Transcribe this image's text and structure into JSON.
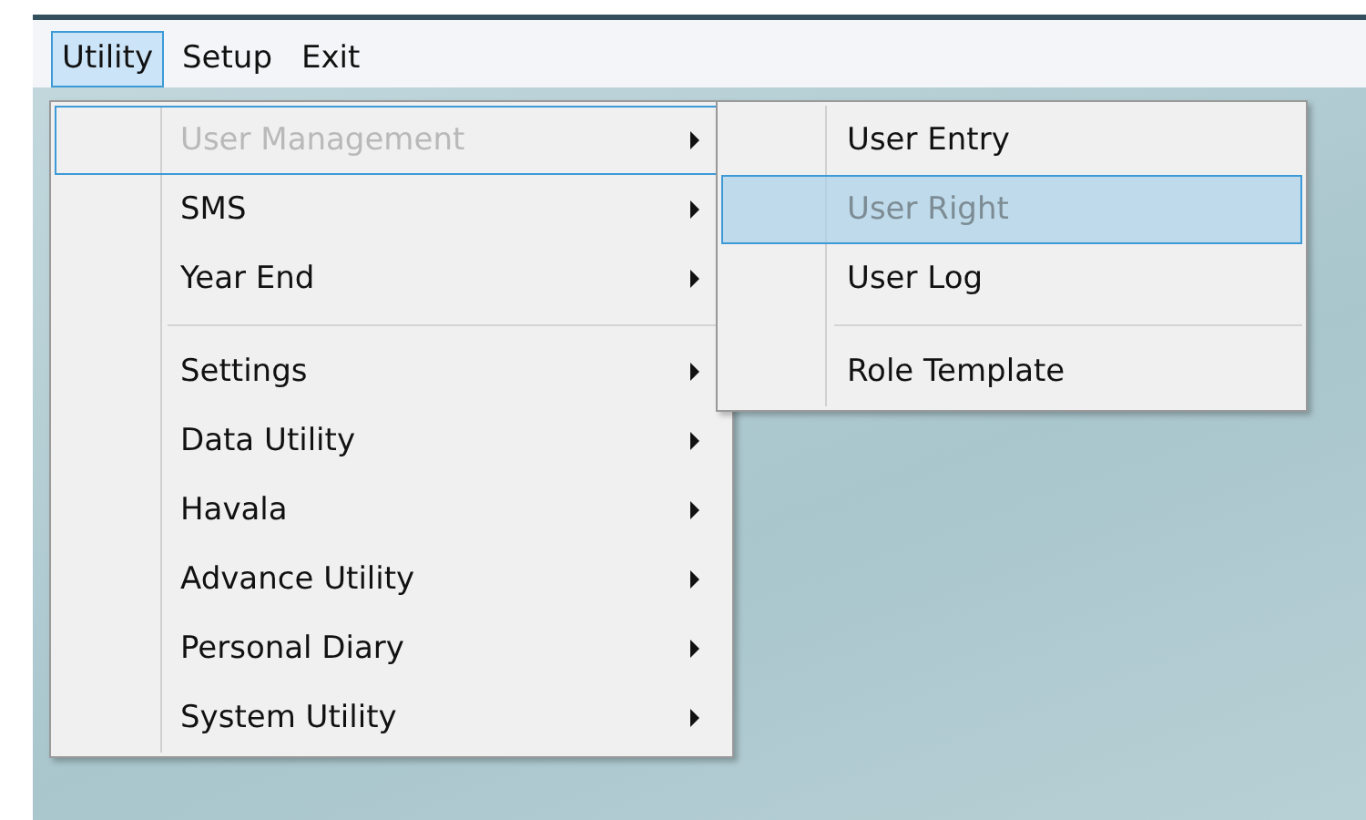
{
  "menubar": [
    {
      "label": "Utility",
      "selected": true
    },
    {
      "label": "Setup",
      "selected": false
    },
    {
      "label": "Exit",
      "selected": false
    }
  ],
  "menu": [
    {
      "kind": "item",
      "label": "User Management",
      "disabled": true,
      "expanded": true
    },
    {
      "kind": "item",
      "label": "SMS",
      "disabled": false,
      "expanded": false
    },
    {
      "kind": "item",
      "label": "Year End",
      "disabled": false,
      "expanded": false
    },
    {
      "kind": "separator"
    },
    {
      "kind": "item",
      "label": "Settings",
      "disabled": false,
      "expanded": false
    },
    {
      "kind": "item",
      "label": "Data Utility",
      "disabled": false,
      "expanded": false
    },
    {
      "kind": "item",
      "label": "Havala",
      "disabled": false,
      "expanded": false
    },
    {
      "kind": "item",
      "label": "Advance Utility",
      "disabled": false,
      "expanded": false
    },
    {
      "kind": "item",
      "label": "Personal Diary",
      "disabled": false,
      "expanded": false
    },
    {
      "kind": "item",
      "label": "System Utility",
      "disabled": false,
      "expanded": false
    }
  ],
  "submenu": [
    {
      "kind": "item",
      "label": "User Entry",
      "disabled": false,
      "selected": false
    },
    {
      "kind": "item",
      "label": "User Right",
      "disabled": true,
      "selected": true
    },
    {
      "kind": "item",
      "label": "User Log",
      "disabled": false,
      "selected": false
    },
    {
      "kind": "separator"
    },
    {
      "kind": "item",
      "label": "Role Template",
      "disabled": false,
      "selected": false
    }
  ]
}
